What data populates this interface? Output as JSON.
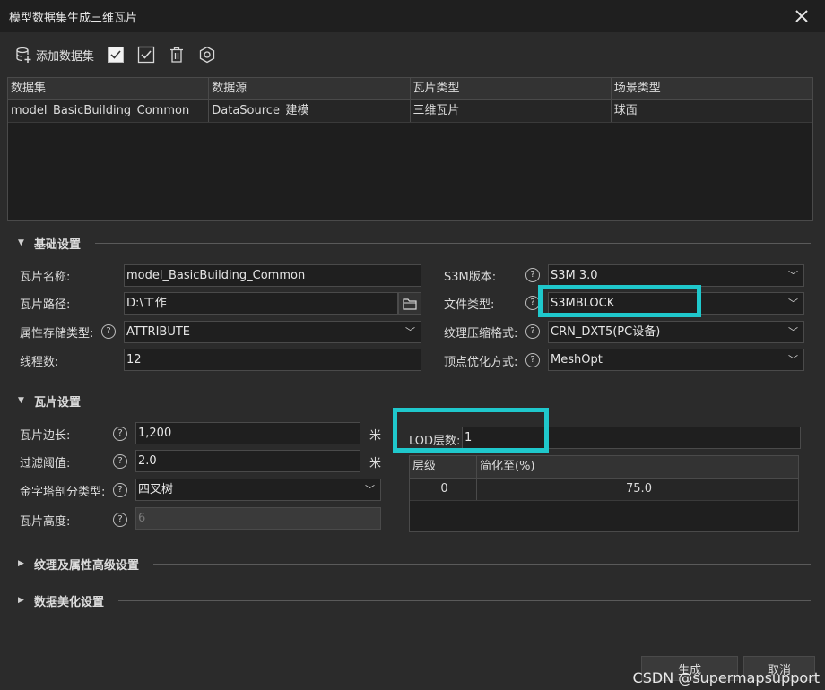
{
  "window": {
    "title": "模型数据集生成三维瓦片",
    "close_icon": "close-icon"
  },
  "toolbar": {
    "add_dataset_label": "添加数据集",
    "select_all_icon": "checkbox-checked-icon",
    "invert_select_icon": "checkbox-outline-checked-icon",
    "delete_icon": "trash-icon",
    "settings_icon": "hexagon-gear-icon"
  },
  "dataset_table": {
    "columns": [
      "数据集",
      "数据源",
      "瓦片类型",
      "场景类型"
    ],
    "rows": [
      [
        "model_BasicBuilding_Common",
        "DataSource_建模",
        "三维瓦片",
        "球面"
      ]
    ]
  },
  "basic_settings": {
    "header": "基础设置",
    "tile_name_label": "瓦片名称:",
    "tile_name_value": "model_BasicBuilding_Common",
    "tile_path_label": "瓦片路径:",
    "tile_path_value": "D:\\工作",
    "attr_storage_label": "属性存储类型:",
    "attr_storage_value": "ATTRIBUTE",
    "thread_count_label": "线程数:",
    "thread_count_value": "12",
    "s3m_version_label": "S3M版本:",
    "s3m_version_value": "S3M 3.0",
    "file_type_label": "文件类型:",
    "file_type_value": "S3MBLOCK",
    "texture_compress_label": "纹理压缩格式:",
    "texture_compress_value": "CRN_DXT5(PC设备)",
    "vertex_opt_label": "顶点优化方式:",
    "vertex_opt_value": "MeshOpt"
  },
  "tile_settings": {
    "header": "瓦片设置",
    "edge_length_label": "瓦片边长:",
    "edge_length_value": "1,200",
    "filter_threshold_label": "过滤阈值:",
    "filter_threshold_value": "2.0",
    "pyramid_type_label": "金字塔剖分类型:",
    "pyramid_type_value": "四叉树",
    "tile_height_label": "瓦片高度:",
    "tile_height_value": "6",
    "unit_meter": "米",
    "lod_count_label": "LOD层数:",
    "lod_count_value": "1",
    "lod_columns": [
      "层级",
      "简化至(%)"
    ],
    "lod_rows": [
      [
        "0",
        "75.0"
      ]
    ]
  },
  "texture_attr_settings": {
    "header": "纹理及属性高级设置"
  },
  "beautify_settings": {
    "header": "数据美化设置"
  },
  "footer": {
    "generate_label": "生成",
    "cancel_label": "取消"
  },
  "watermark": "CSDN @supermapsupport",
  "colors": {
    "highlight": "#1fc8cc",
    "background": "#2b2b2b",
    "titlebar": "#1f1f1f"
  }
}
